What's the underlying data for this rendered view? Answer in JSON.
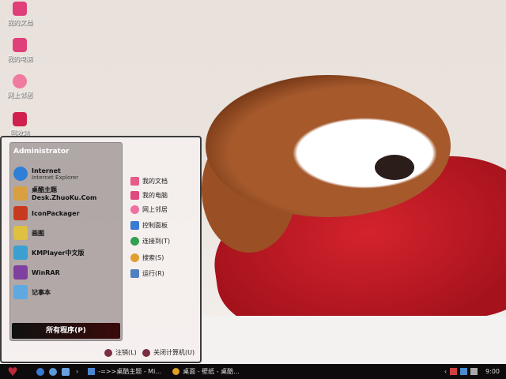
{
  "desktop_icons": [
    {
      "label": "我的文档"
    },
    {
      "label": "我的电脑"
    },
    {
      "label": "网上邻居"
    },
    {
      "label": "回收站"
    }
  ],
  "start_menu": {
    "user": "Administrator",
    "programs": [
      {
        "name": "Internet",
        "sub": "Internet Explorer",
        "color": "#2f7fd8"
      },
      {
        "name": "桌酷主题Desk.ZhuoKu.Com",
        "color": "#d8a040"
      },
      {
        "name": "IconPackager",
        "color": "#c83a20"
      },
      {
        "name": "画图",
        "color": "#e0c040"
      },
      {
        "name": "KMPlayer中文版",
        "color": "#3aa0d0"
      },
      {
        "name": "WinRAR",
        "color": "#8040a0"
      },
      {
        "name": "记事本",
        "color": "#60a8e0"
      }
    ],
    "all_programs": "所有程序(P)",
    "places": [
      {
        "label": "我的文档",
        "color": "#e85a8a"
      },
      {
        "label": "我的电脑",
        "color": "#e04880"
      },
      {
        "label": "网上邻居",
        "color": "#f070a0"
      },
      {
        "label": "控制面板",
        "color": "#3a7ad0"
      },
      {
        "label": "连接到(T)",
        "color": "#30a050"
      },
      {
        "label": "搜索(S)",
        "color": "#e0a030"
      },
      {
        "label": "运行(R)",
        "color": "#5080c0"
      }
    ],
    "logoff": "注销(L)",
    "shutdown": "关闭计算机(U)"
  },
  "taskbar": {
    "arrow": "›",
    "tasks": [
      {
        "label": "-=>>桌酷主题 - Mi..."
      },
      {
        "label": "桌面 - 壁纸 - 桌酷..."
      }
    ],
    "tray_chevron": "‹",
    "clock": "9:00"
  }
}
